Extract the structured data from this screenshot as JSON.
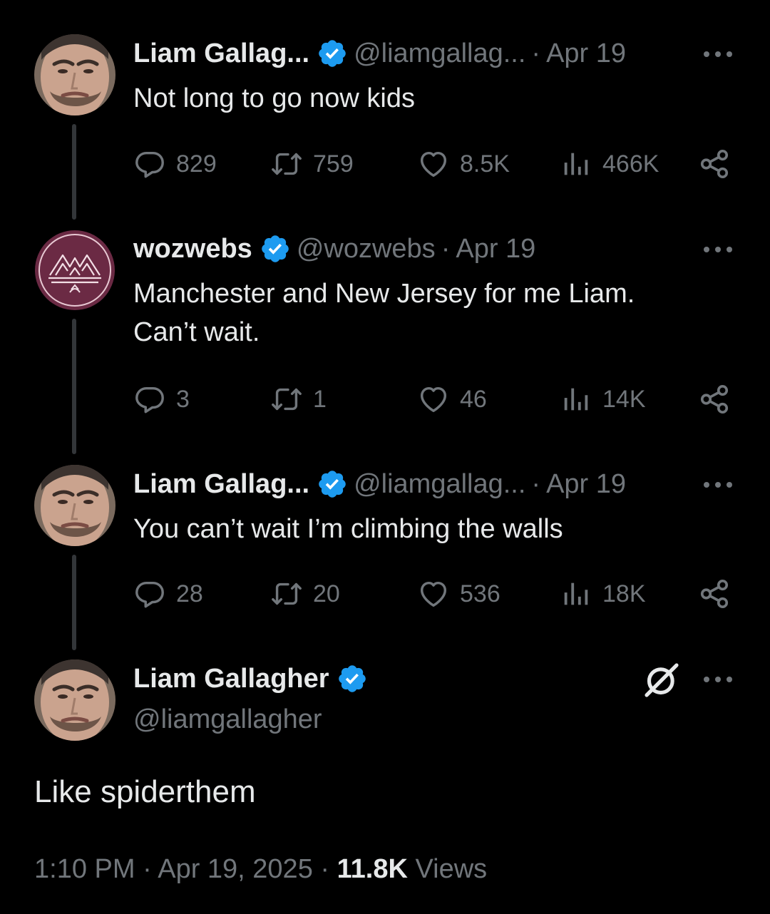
{
  "tweets": [
    {
      "name": "Liam Gallag...",
      "handle": "@liamgallag...",
      "separator": "·",
      "date": "Apr 19",
      "text": "Not long to go now kids",
      "replies": "829",
      "retweets": "759",
      "likes": "8.5K",
      "views": "466K"
    },
    {
      "name": "wozwebs",
      "handle": "@wozwebs",
      "separator": "·",
      "date": "Apr 19",
      "text": "Manchester and New Jersey for me Liam.\nCan’t wait.",
      "replies": "3",
      "retweets": "1",
      "likes": "46",
      "views": "14K"
    },
    {
      "name": "Liam Gallag...",
      "handle": "@liamgallag...",
      "separator": "·",
      "date": "Apr 19",
      "text": "You can’t wait I’m climbing the walls",
      "replies": "28",
      "retweets": "20",
      "likes": "536",
      "views": "18K"
    }
  ],
  "main_tweet": {
    "name": "Liam Gallagher",
    "handle": "@liamgallagher",
    "text": "Like spiderthem",
    "time": "1:10 PM",
    "separator": "·",
    "date": "Apr 19, 2025",
    "views_count": "11.8K",
    "views_label": "Views"
  },
  "colors": {
    "background": "#000000",
    "text": "#e7e9ea",
    "secondary": "#71767b",
    "verified": "#1d9bf0",
    "wozwebs_avatar": "#6b2a44"
  },
  "icons": [
    "verified-badge-icon",
    "more-icon",
    "reply-icon",
    "retweet-icon",
    "like-icon",
    "views-icon",
    "share-icon",
    "grok-icon"
  ]
}
